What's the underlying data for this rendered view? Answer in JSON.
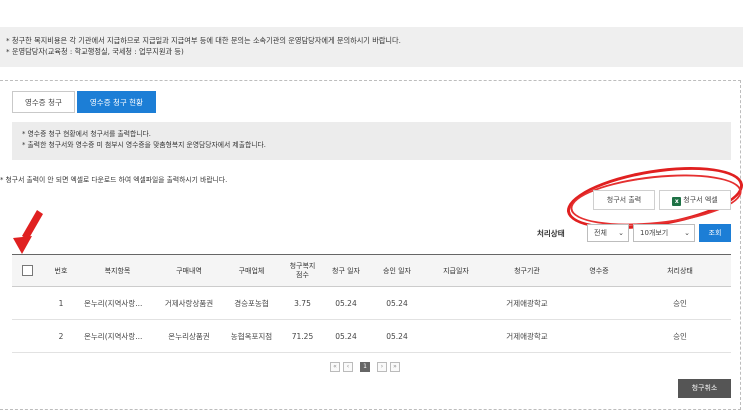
{
  "notice": {
    "line1": "* 청구한 복지비용은 각 기관에서 지급하므로 지급일과 지급여부 등에 대한 문의는 소속기관의 운영담당자에게 문의하시기 바랍니다.",
    "line2": "* 운영담당자(교육청 : 학교행정실, 국세청 : 업무지원과 등)"
  },
  "tabs": [
    {
      "label": "영수증 청구",
      "active": false
    },
    {
      "label": "영수증 청구 현황",
      "active": true
    }
  ],
  "info": {
    "line1": "* 영수증 청구 현황에서 청구서를 출력합니다.",
    "line2": "* 출력한 청구서와 영수증 미 첨부시 영수증을 맞춤형복지 운영담당자에서 제출합니다."
  },
  "excel_note": "* 청구서 출력이 안 되면 엑셀로 다운로드 하여 엑셀파일을 출력하시기 바랍니다.",
  "toolbar": {
    "print_label": "청구서 출력",
    "excel_label": "청구서 엑셀",
    "excel_icon": "excel-icon"
  },
  "filter": {
    "status_label": "처리상태",
    "status_value": "전체",
    "count_value": "10개보기",
    "search_label": "조회"
  },
  "table": {
    "headers": [
      "번호",
      "복지항목",
      "구매내역",
      "구매업체",
      "청구복지\n점수",
      "청구 일자",
      "승인 일자",
      "지급일자",
      "청구기관",
      "영수증",
      "처리상태"
    ],
    "rows": [
      [
        "1",
        "온누리(지역사랑...",
        "거제사랑상품권",
        "경승포농협",
        "3.75",
        "05.24",
        "05.24",
        "",
        "거제애광학교",
        "",
        "승인"
      ],
      [
        "2",
        "온누리(지역사랑...",
        "온누리상품권",
        "농협옥포지점",
        "71.25",
        "05.24",
        "05.24",
        "",
        "거제애광학교",
        "",
        "승인"
      ]
    ]
  },
  "pager": {
    "first": "«",
    "prev": "‹",
    "current": "1",
    "next": "›",
    "last": "»"
  },
  "cancel_label": "청구취소",
  "colors": {
    "accent": "#1c7ed6",
    "annotation": "#e02020",
    "dark_button": "#555555"
  }
}
